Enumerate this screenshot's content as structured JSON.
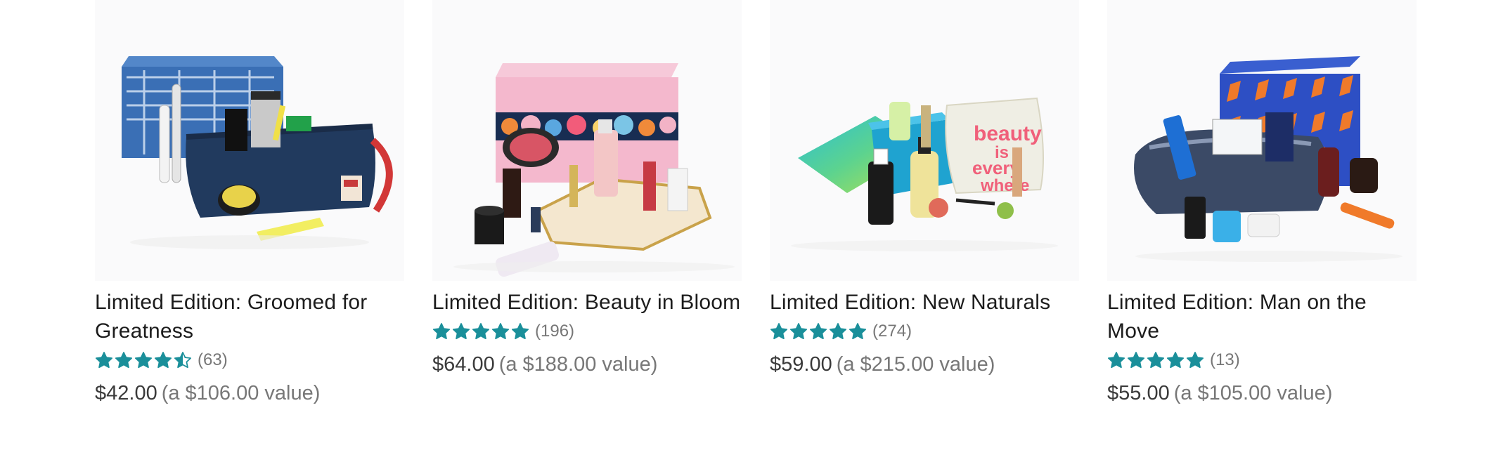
{
  "colors": {
    "star": "#1a8f9a",
    "star_empty": "#cfe8eb",
    "title": "#1c1c1c",
    "muted": "#777777"
  },
  "products": [
    {
      "title": "Limited Edition: Groomed for Greatness",
      "rating": 4.5,
      "review_count": "(63)",
      "price": "$42.00",
      "value_text": "(a $106.00 value)",
      "image_icon": "grooming-kit-image"
    },
    {
      "title": "Limited Edition: Beauty in Bloom",
      "rating": 5,
      "review_count": "(196)",
      "price": "$64.00",
      "value_text": "(a $188.00 value)",
      "image_icon": "beauty-box-image"
    },
    {
      "title": "Limited Edition: New Naturals",
      "rating": 5,
      "review_count": "(274)",
      "price": "$59.00",
      "value_text": "(a $215.00 value)",
      "image_icon": "naturals-box-image"
    },
    {
      "title": "Limited Edition: Man on the Move",
      "rating": 5,
      "review_count": "(13)",
      "price": "$55.00",
      "value_text": "(a $105.00 value)",
      "image_icon": "travel-kit-image"
    }
  ],
  "image_texts": {
    "bag_word_1": "beauty",
    "bag_word_2": "is",
    "bag_word_3": "every",
    "bag_word_4": "where"
  }
}
